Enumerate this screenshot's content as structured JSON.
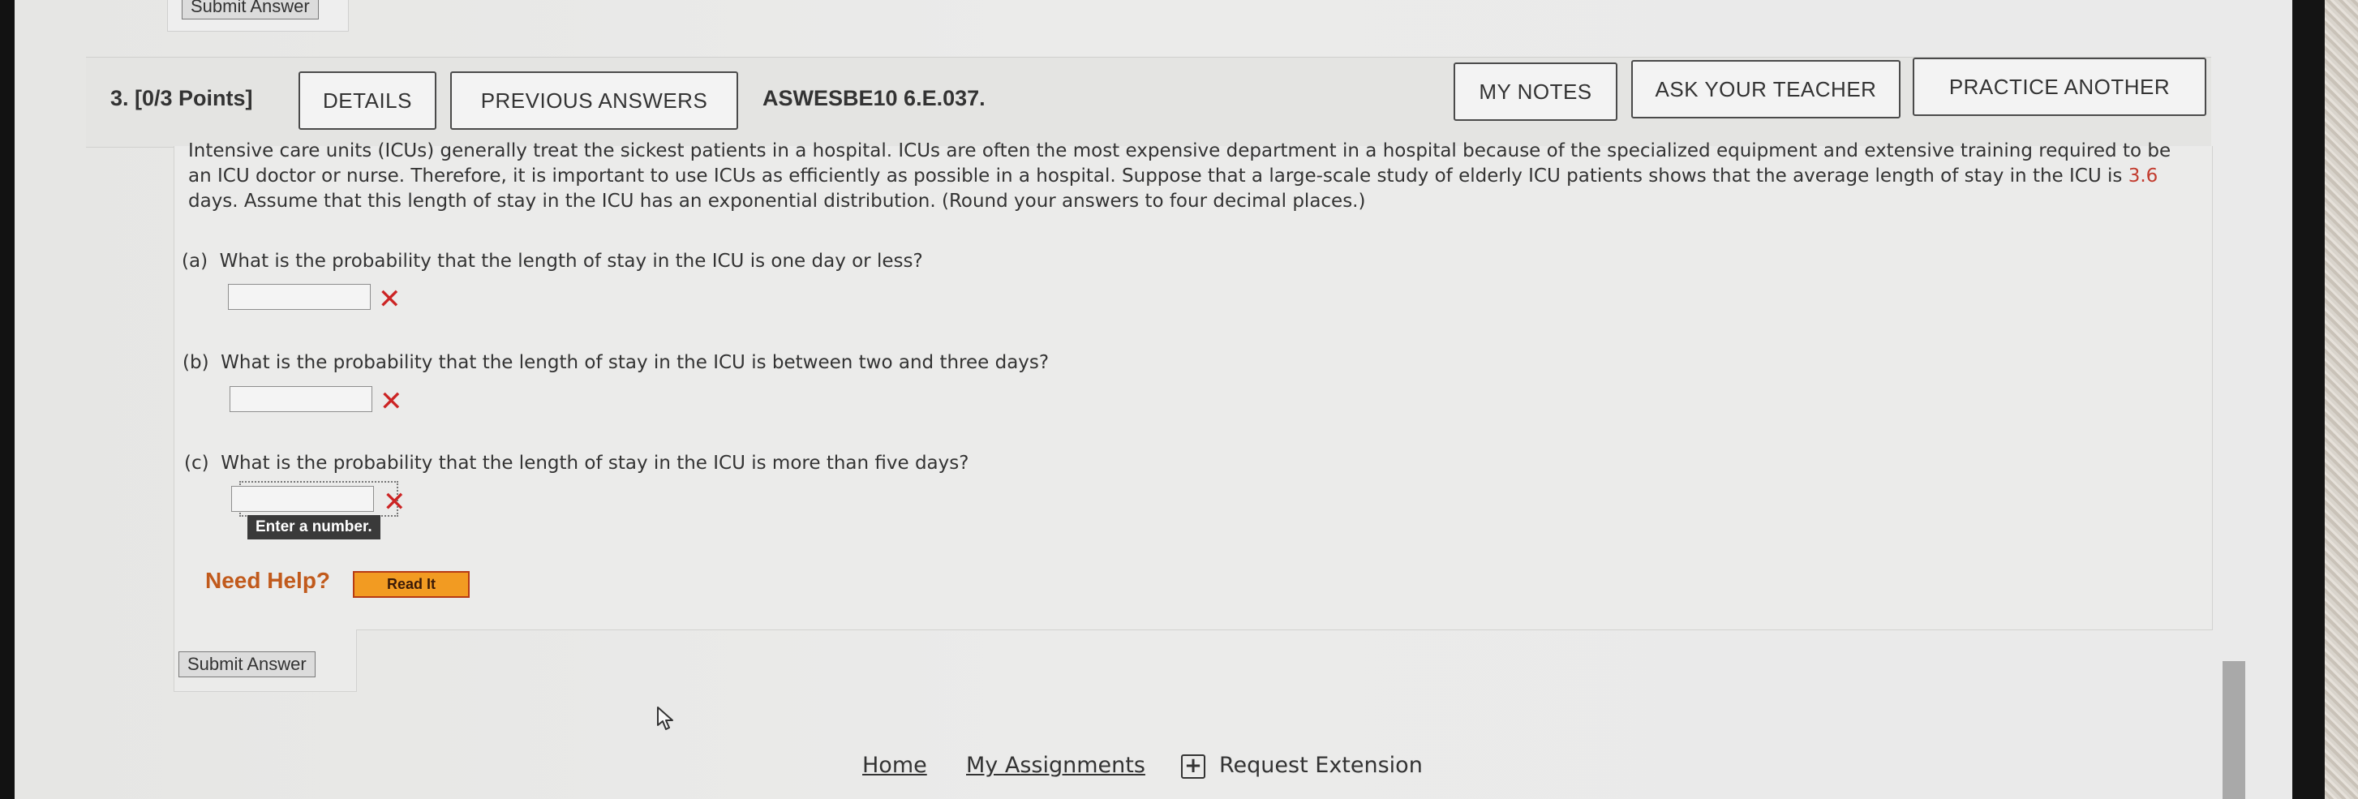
{
  "top": {
    "submit_label": "Submit Answer"
  },
  "question": {
    "number_points": "3.  [0/3 Points]",
    "buttons": {
      "details": "DETAILS",
      "previous_answers": "PREVIOUS ANSWERS",
      "my_notes": "MY NOTES",
      "ask_teacher": "ASK YOUR TEACHER",
      "practice_another": "PRACTICE ANOTHER"
    },
    "assignment_code": "ASWESBE10 6.E.037.",
    "problem_text_before": "Intensive care units (ICUs) generally treat the sickest patients in a hospital. ICUs are often the most expensive department in a hospital because of the specialized equipment and extensive training required to be an ICU doctor or nurse. Therefore, it is important to use ICUs as efficiently as possible in a hospital. Suppose that a large-scale study of elderly ICU patients shows that the average length of stay in the ICU is ",
    "problem_value": "3.6",
    "problem_text_after": " days. Assume that this length of stay in the ICU has an exponential distribution. (Round your answers to four decimal places.)",
    "parts": [
      {
        "label": "(a)",
        "text": "What is the probability that the length of stay in the ICU is one day or less?",
        "value": ""
      },
      {
        "label": "(b)",
        "text": "What is the probability that the length of stay in the ICU is between two and three days?",
        "value": ""
      },
      {
        "label": "(c)",
        "text": "What is the probability that the length of stay in the ICU is more than five days?",
        "value": ""
      }
    ],
    "incorrect_mark": "✕",
    "tooltip": "Enter a number.",
    "need_help": "Need Help?",
    "read_it": "Read It",
    "submit_label": "Submit Answer"
  },
  "footer": {
    "home": "Home",
    "my_assignments": "My Assignments",
    "request_extension": "Request Extension",
    "extension_icon_glyph": "+"
  },
  "colors": {
    "accent_value": "#c23b2e",
    "incorrect": "#cc2424",
    "need_help": "#c15a1c",
    "read_it_bg": "#f29b22"
  }
}
